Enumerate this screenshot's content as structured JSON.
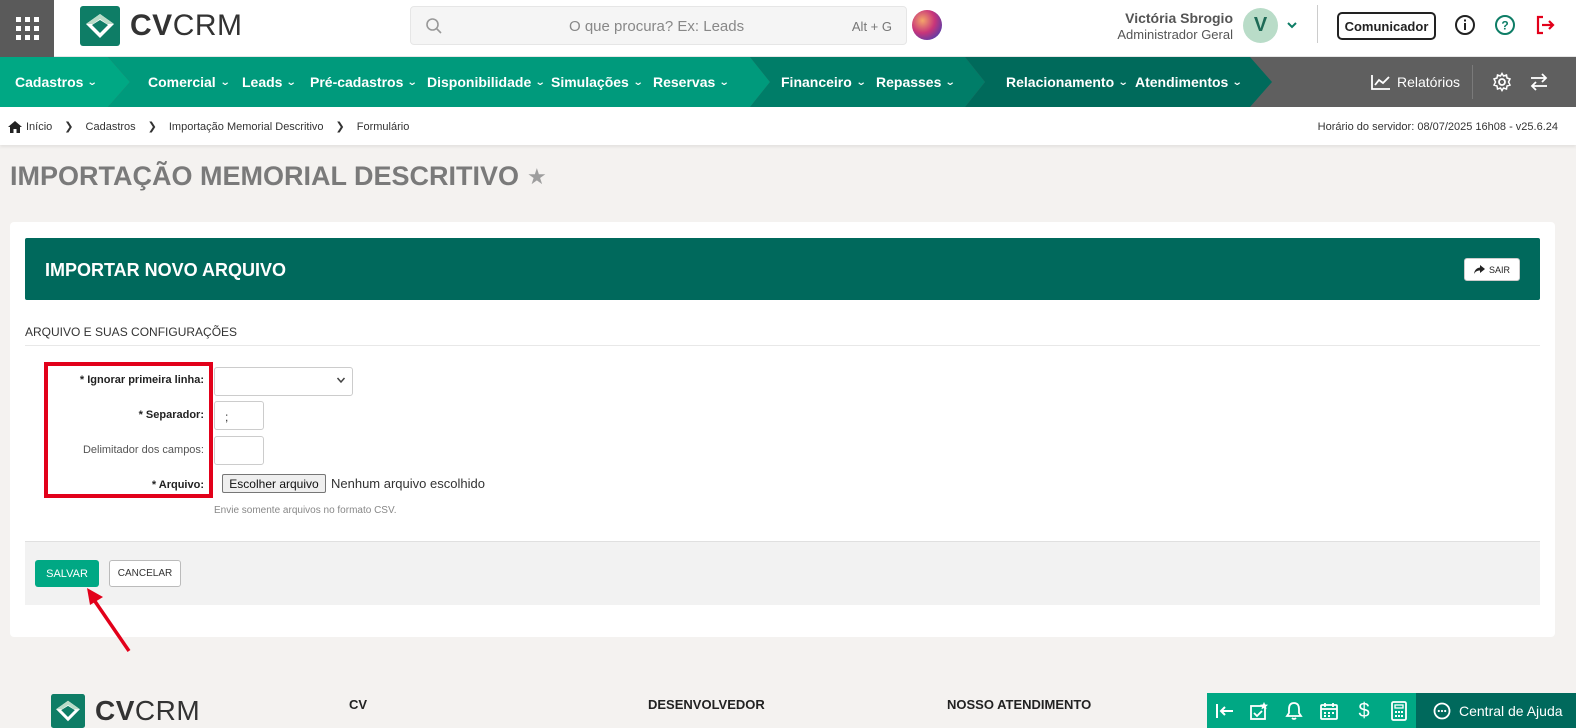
{
  "header": {
    "logo_text_bold": "CV",
    "logo_text_rest": "CRM",
    "search_placeholder": "O que procura? Ex: Leads",
    "search_shortcut": "Alt + G",
    "user_name": "Victória Sbrogio",
    "user_role": "Administrador Geral",
    "avatar_letter": "V",
    "comunicador_label": "Comunicador"
  },
  "nav": {
    "items": [
      {
        "label": "Cadastros"
      },
      {
        "label": "Comercial"
      },
      {
        "label": "Leads"
      },
      {
        "label": "Pré-cadastros"
      },
      {
        "label": "Disponibilidade"
      },
      {
        "label": "Simulações"
      },
      {
        "label": "Reservas"
      },
      {
        "label": "Financeiro"
      },
      {
        "label": "Repasses"
      },
      {
        "label": "Relacionamento"
      },
      {
        "label": "Atendimentos"
      }
    ],
    "relatorios_label": "Relatórios"
  },
  "breadcrumb": {
    "items": [
      "Início",
      "Cadastros",
      "Importação Memorial Descritivo",
      "Formulário"
    ],
    "server_time": "Horário do servidor: 08/07/2025 16h08 - v25.6.24"
  },
  "page": {
    "title": "IMPORTAÇÃO MEMORIAL DESCRITIVO"
  },
  "panel": {
    "title": "IMPORTAR NOVO ARQUIVO",
    "sair_label": "SAIR",
    "section_label": "ARQUIVO E SUAS CONFIGURAÇÕES",
    "fields": {
      "ignorar_label": "* Ignorar primeira linha:",
      "ignorar_value": "",
      "separador_label": "* Separador:",
      "separador_value": ";",
      "delimitador_label": "Delimitador dos campos:",
      "delimitador_value": "",
      "arquivo_label": "* Arquivo:",
      "file_button": "Escolher arquivo",
      "file_status": "Nenhum arquivo escolhido",
      "hint": "Envie somente arquivos no formato CSV."
    },
    "salvar_label": "SALVAR",
    "cancelar_label": "CANCELAR"
  },
  "footer": {
    "logo_text_bold": "CV",
    "logo_text_rest": "CRM",
    "col1": "CV",
    "col2": "DESENVOLVEDOR",
    "col3": "NOSSO ATENDIMENTO",
    "help_label": "Central de Ajuda"
  },
  "colors": {
    "brand_green": "#00a884",
    "brand_dark": "#00695c",
    "nav_gray": "#5f5f5f",
    "highlight_red": "#e2001a"
  }
}
